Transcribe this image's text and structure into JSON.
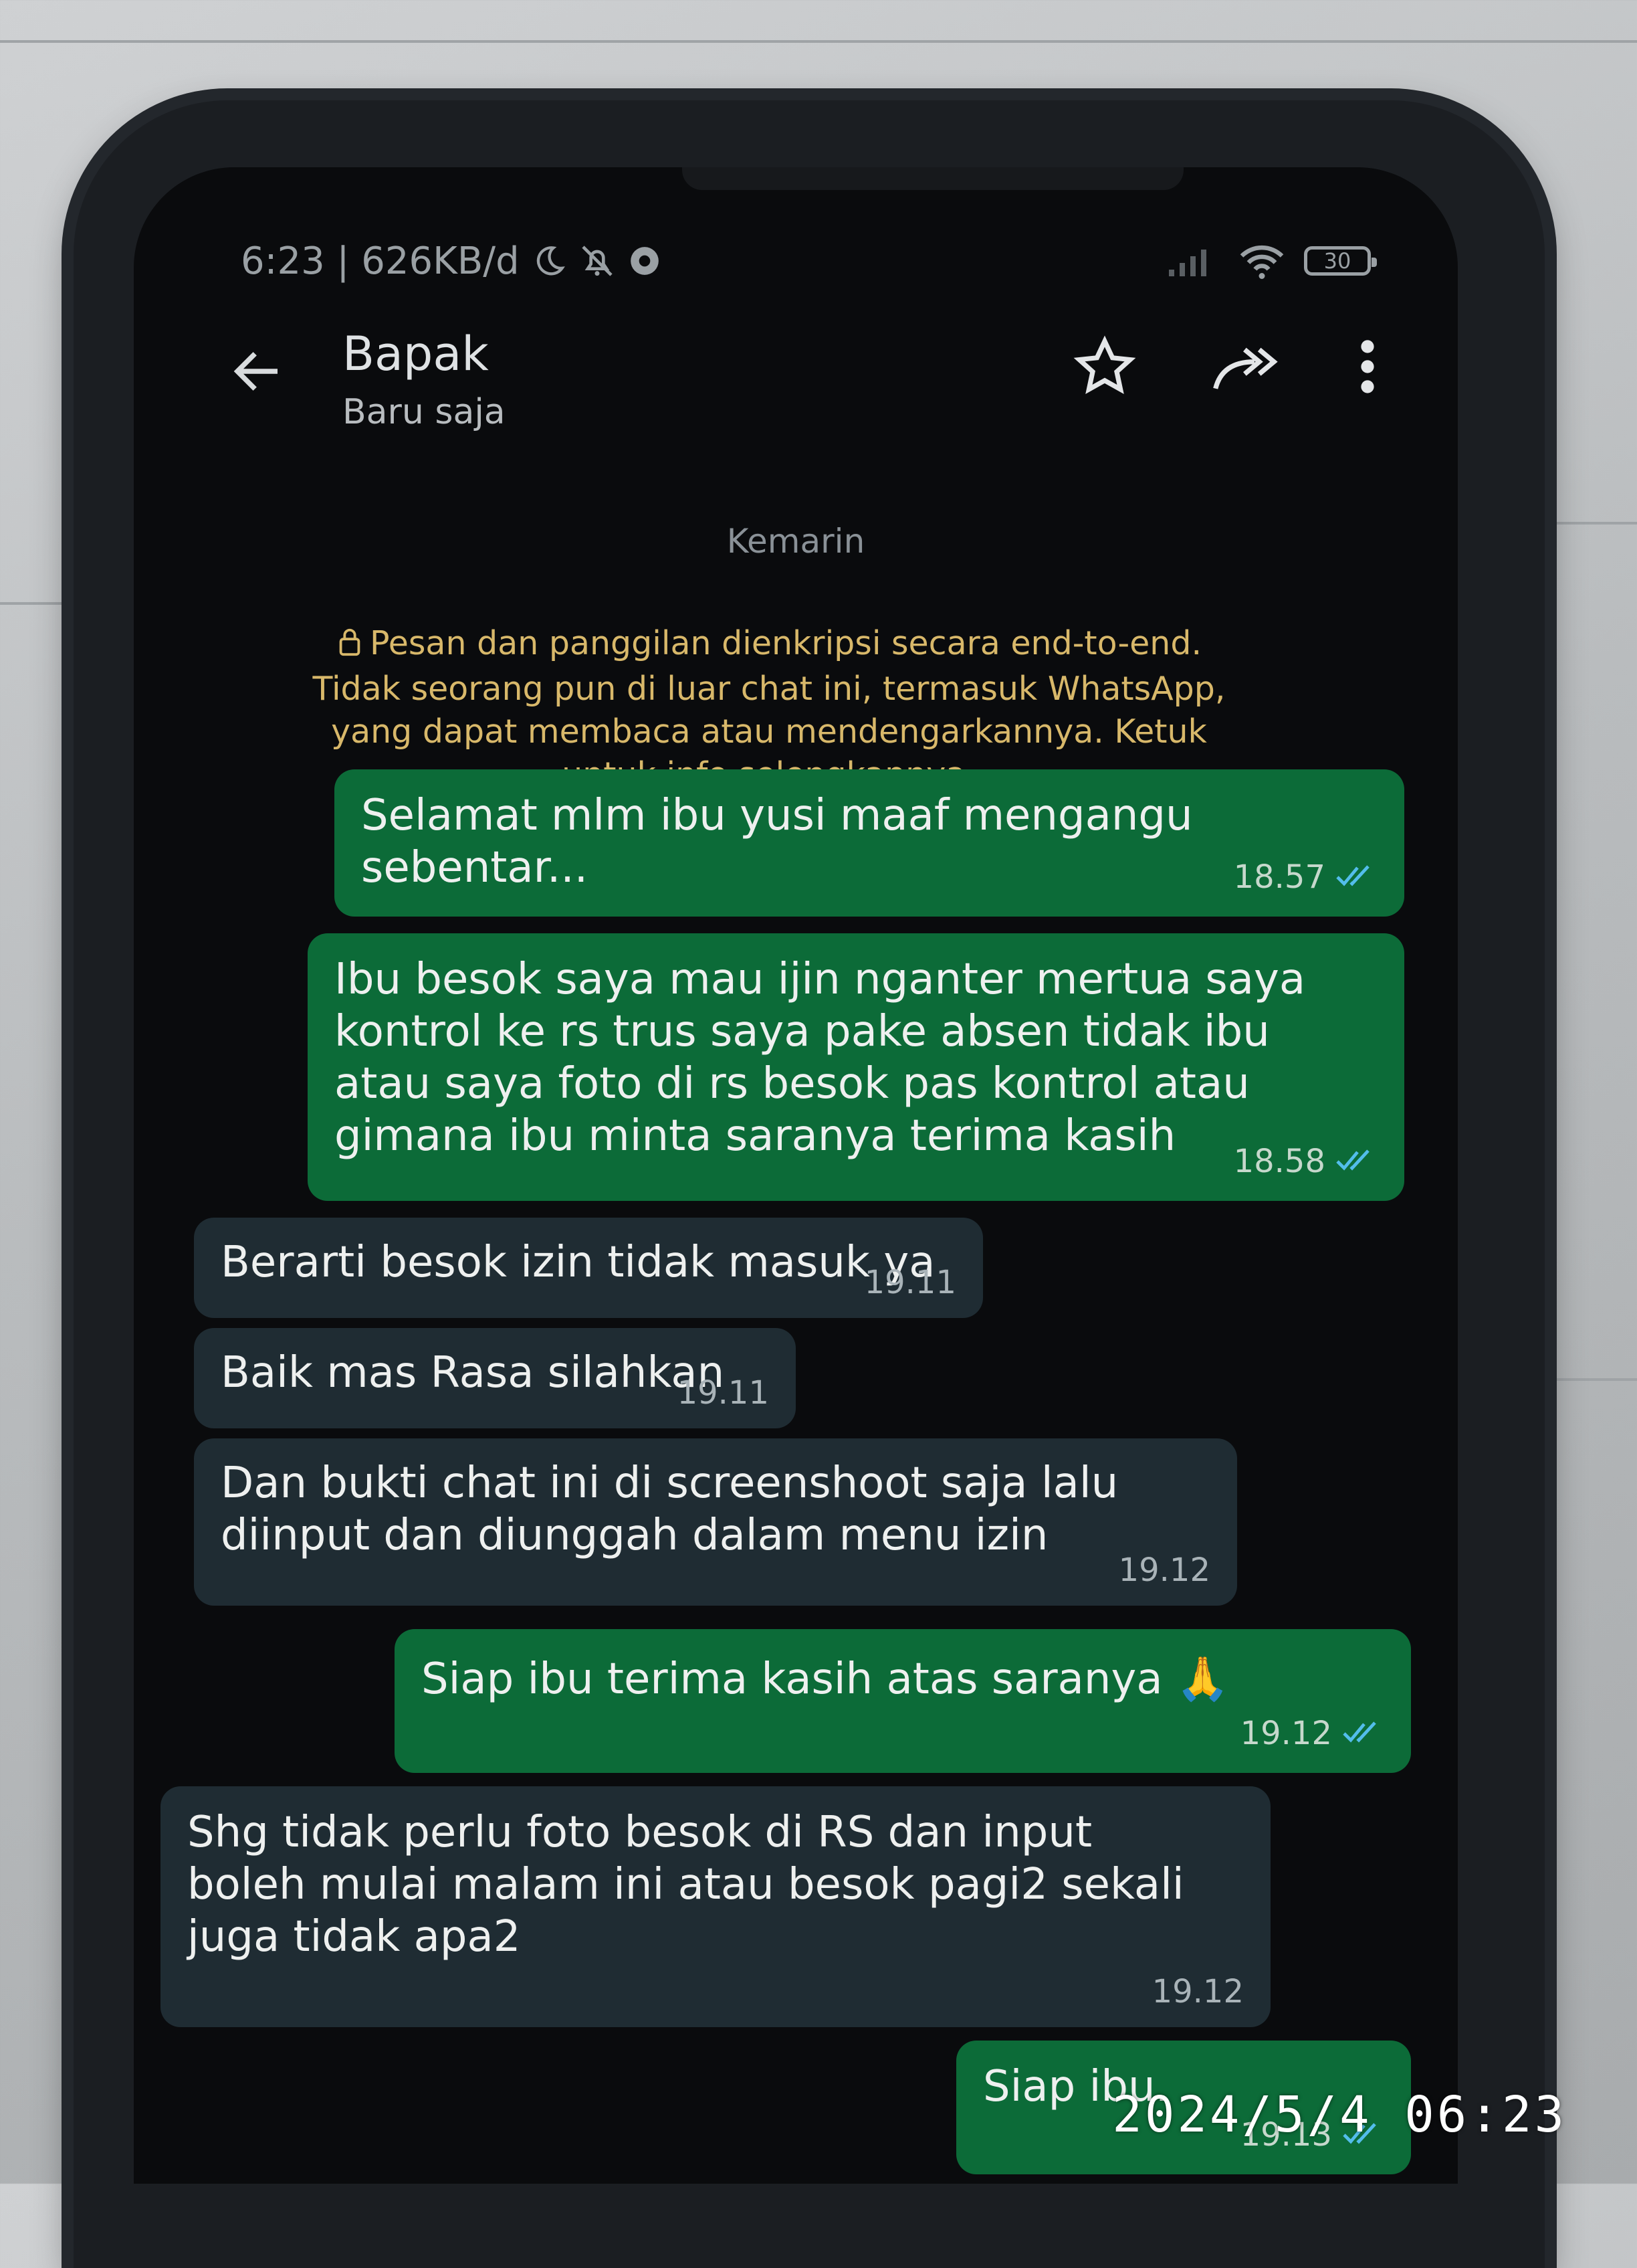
{
  "status_bar": {
    "time_speed": "6:23 | 626KB/d",
    "icons": [
      "moon-icon",
      "bell-off-icon",
      "chrome-icon",
      "signal-icon",
      "wifi-icon",
      "battery-icon"
    ],
    "battery_level": "30"
  },
  "header": {
    "contact_name": "Bapak",
    "contact_status": "Baru saja",
    "icons": [
      "back-arrow-icon",
      "star-icon",
      "forward-icon",
      "more-vertical-icon"
    ]
  },
  "chat": {
    "date_label": "Kemarin",
    "encryption_notice": "Pesan dan panggilan dienkripsi secara end-to-end. Tidak seorang pun di luar chat ini, termasuk WhatsApp, yang dapat membaca atau mendengarkannya. Ketuk untuk info selengkapnya.",
    "messages": [
      {
        "direction": "out",
        "text": "Selamat mlm ibu yusi maaf mengangu sebentar...",
        "time": "18.57",
        "read": true
      },
      {
        "direction": "out",
        "text": "Ibu besok saya mau ijin nganter mertua saya kontrol ke rs trus saya pake absen tidak ibu atau saya foto di rs besok pas kontrol atau gimana ibu minta saranya terima kasih",
        "time": "18.58",
        "read": true
      },
      {
        "direction": "in",
        "text": "Berarti besok izin tidak masuk ya",
        "time": "19.11"
      },
      {
        "direction": "in",
        "text": "Baik mas Rasa silahkan",
        "time": "19.11"
      },
      {
        "direction": "in",
        "text": "Dan bukti chat ini di screenshoot saja lalu diinput dan diunggah dalam menu izin",
        "time": "19.12"
      },
      {
        "direction": "out",
        "text": "Siap ibu terima kasih atas saranya 🙏",
        "time": "19.12",
        "read": true
      },
      {
        "direction": "in",
        "text": "Shg tidak perlu foto besok di RS dan input boleh mulai malam ini atau besok pagi2 sekali juga tidak apa2",
        "time": "19.12"
      },
      {
        "direction": "out",
        "text": "Siap ibu.",
        "time": "19.13",
        "read": true
      }
    ]
  },
  "photo_timestamp": "2024/5/4 06:23",
  "colors": {
    "outgoing_bubble": "#0c6b38",
    "incoming_bubble": "#1f2c33",
    "encryption_text": "#d8b86a",
    "read_ticks": "#53bdeb"
  }
}
